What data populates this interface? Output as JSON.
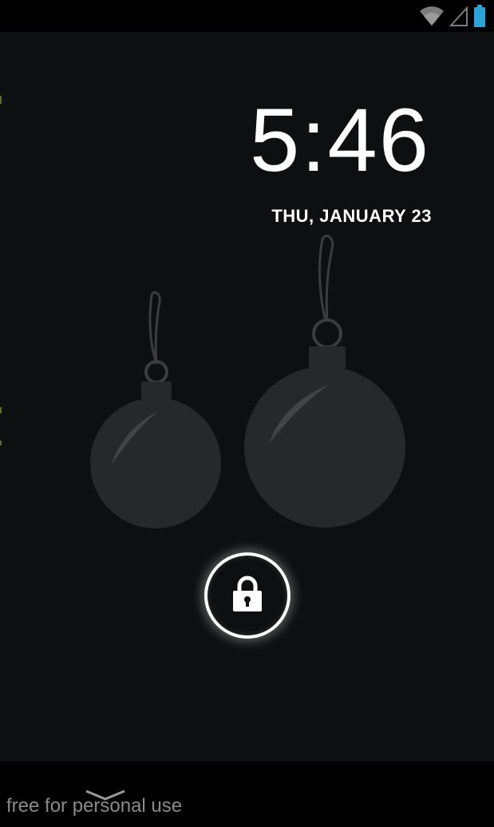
{
  "status_bar": {
    "icons": [
      "wifi-icon",
      "cell-signal-icon",
      "battery-icon"
    ],
    "battery_color": "#29a3d8"
  },
  "lockscreen": {
    "time": "5:46",
    "date": "THU, JANUARY 23"
  },
  "wallpaper": {
    "ornament_color": "#262829",
    "highlight_color": "#414344"
  },
  "unlock": {
    "icon": "padlock-icon"
  },
  "nav_bar": {
    "watermark": "free for personal use",
    "icon": "chevron-down-icon"
  }
}
